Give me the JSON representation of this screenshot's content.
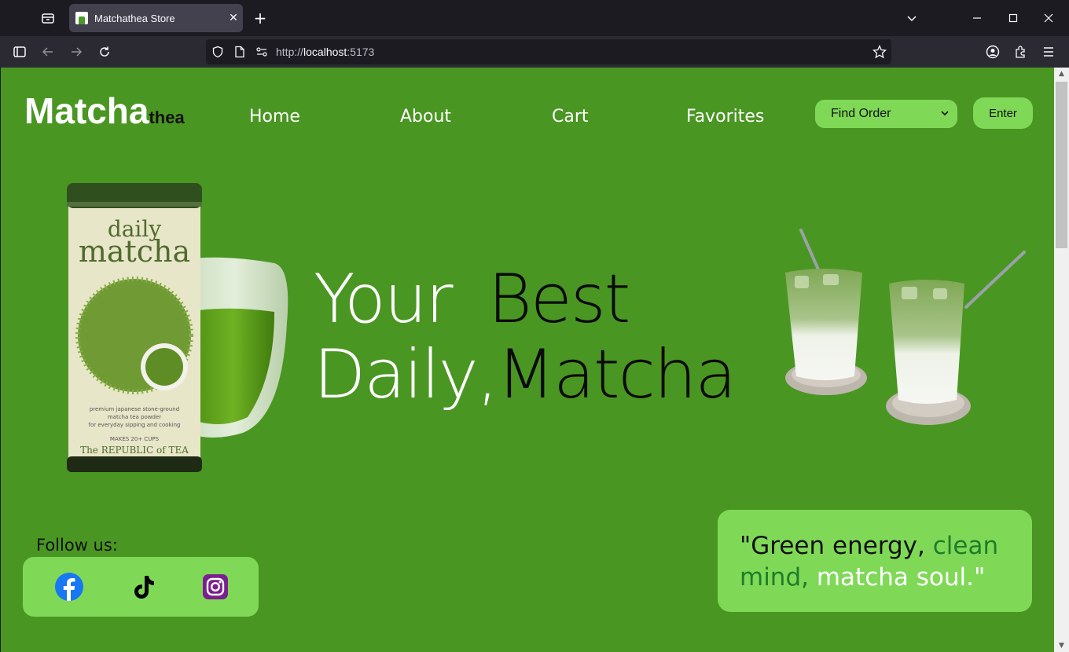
{
  "browser": {
    "tab_title": "Matchathea Store",
    "url_protocol": "http://",
    "url_host": "localhost",
    "url_port": ":5173"
  },
  "site": {
    "logo_main": "Matcha",
    "logo_sub": "thea",
    "nav": [
      "Home",
      "About",
      "Cart",
      "Favorites"
    ],
    "find_order_select": "Find Order",
    "enter_button": "Enter"
  },
  "hero": {
    "line1_white": "Your",
    "line1_black": "Best",
    "line2_white": "Daily,",
    "line2_black": "Matcha",
    "tin_brand_line1": "daily",
    "tin_brand_line2": "matcha",
    "tin_caption_1": "premium japanese stone-ground",
    "tin_caption_2": "matcha tea powder",
    "tin_caption_3": "for everyday sipping and cooking",
    "tin_caption_4": "MAKES 20+ CUPS",
    "tin_maker": "The REPUBLIC of TEA"
  },
  "social": {
    "label": "Follow us:",
    "icons": [
      "facebook-icon",
      "tiktok-icon",
      "instagram-icon"
    ]
  },
  "quote": {
    "part1": "\"Green energy, ",
    "part2": "clean mind,",
    "part3": " matcha soul.\""
  },
  "colors": {
    "page_bg": "#4a9622",
    "accent_light": "#7fd957",
    "quote_green": "#1e7d2a"
  }
}
